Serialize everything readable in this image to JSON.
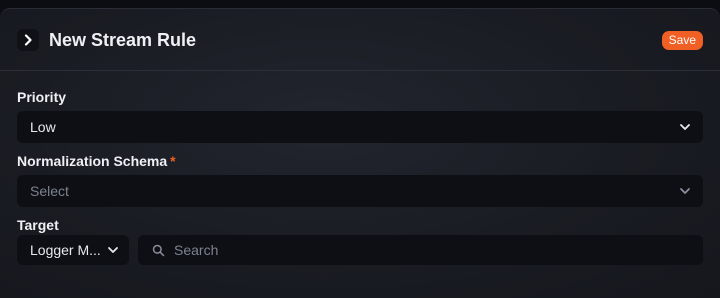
{
  "header": {
    "title": "New Stream Rule",
    "save_label": "Save"
  },
  "priority": {
    "label": "Priority",
    "value": "Low"
  },
  "schema": {
    "label": "Normalization Schema",
    "required_mark": "*",
    "placeholder": "Select"
  },
  "target": {
    "label": "Target",
    "type_value": "Logger M...",
    "search_placeholder": "Search"
  },
  "colors": {
    "accent": "#f05f24",
    "panel": "#1a1c23",
    "field": "#0d0f14"
  }
}
